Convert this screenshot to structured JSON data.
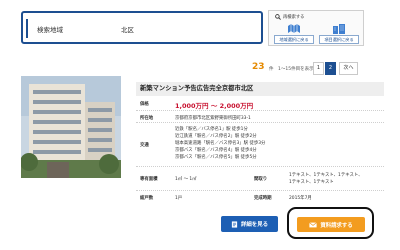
{
  "search": {
    "area_label": "検索地域",
    "area_value": "北区"
  },
  "reselect": {
    "title": "再検索する",
    "area_button": "地域選択に戻る",
    "item_button": "項目選択に戻る"
  },
  "results": {
    "count": "23",
    "range": "件　1〜15件目を表示",
    "pages": [
      "1",
      "2"
    ],
    "current_page": "1",
    "next": "次へ"
  },
  "property": {
    "title": "新築マンション予告広告完全京都市北区",
    "price_label": "価格",
    "price": "1,000万円 ～ 2,000万円",
    "address_label": "所在地",
    "address": "京都府京都市北区紫野東御所田町33-1",
    "traffic_label": "交通",
    "traffic": [
      "近鉄「駅名／バス停名1」駅 徒歩1分",
      "近江鉄道「駅名／バス停名2」駅 徒歩2分",
      "堀本高速道路「駅名／バス停名3」駅 徒歩3分",
      "京都バス「駅名／バス停名4」駅 徒歩4分",
      "京都バス「駅名／バス停名5」駅 徒歩5分"
    ],
    "area_label": "専有面積",
    "area": "1㎡ ～ 1㎡",
    "layout_label": "間取り",
    "layout": [
      "1テキスト、1テキスト、1テキスト、",
      "1テキスト、1テキスト"
    ],
    "units_label": "総戸数",
    "units": "1戸",
    "completion_label": "完成時期",
    "completion": "2015年7月"
  },
  "actions": {
    "detail": "詳細を見る",
    "request": "資料請求する"
  },
  "colors": {
    "navy": "#1d4f91",
    "orange": "#f39c1f",
    "price_red": "#c8102e",
    "count_orange": "#e58a00"
  }
}
